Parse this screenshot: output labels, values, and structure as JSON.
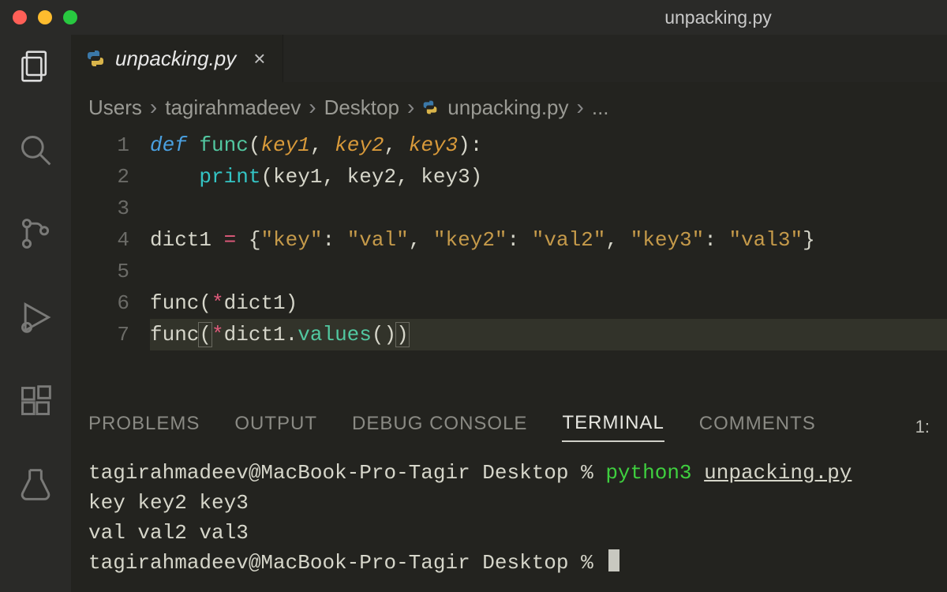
{
  "window": {
    "title": "unpacking.py"
  },
  "activitybar": {
    "items": [
      {
        "name": "explorer-icon",
        "active": true
      },
      {
        "name": "search-icon",
        "active": false
      },
      {
        "name": "source-control-icon",
        "active": false
      },
      {
        "name": "run-debug-icon",
        "active": false
      },
      {
        "name": "extensions-icon",
        "active": false
      },
      {
        "name": "testing-icon",
        "active": false
      }
    ]
  },
  "tab": {
    "filename": "unpacking.py",
    "icon": "python-file-icon",
    "close_label": "×"
  },
  "breadcrumbs": {
    "segments": [
      "Users",
      "tagirahmadeev",
      "Desktop",
      "unpacking.py",
      "..."
    ],
    "file_icon": "python-file-icon"
  },
  "editor": {
    "line_numbers": [
      "1",
      "2",
      "3",
      "4",
      "5",
      "6",
      "7"
    ],
    "code_lines": [
      {
        "raw": "def func(key1, key2, key3):",
        "tokens": [
          {
            "t": "def ",
            "c": "tok-kw"
          },
          {
            "t": "func",
            "c": "tok-fn"
          },
          {
            "t": "(",
            "c": "tok-ident"
          },
          {
            "t": "key1",
            "c": "tok-param"
          },
          {
            "t": ", ",
            "c": "tok-ident"
          },
          {
            "t": "key2",
            "c": "tok-param"
          },
          {
            "t": ", ",
            "c": "tok-ident"
          },
          {
            "t": "key3",
            "c": "tok-param"
          },
          {
            "t": "):",
            "c": "tok-ident"
          }
        ]
      },
      {
        "raw": "    print(key1, key2, key3)",
        "tokens": [
          {
            "t": "    ",
            "c": ""
          },
          {
            "t": "print",
            "c": "tok-print"
          },
          {
            "t": "(key1, key2, key3)",
            "c": "tok-ident"
          }
        ]
      },
      {
        "raw": "",
        "tokens": []
      },
      {
        "raw": "dict1 = {\"key\": \"val\", \"key2\": \"val2\", \"key3\": \"val3\"}",
        "tokens": [
          {
            "t": "dict1 ",
            "c": "tok-ident"
          },
          {
            "t": "=",
            "c": "tok-op"
          },
          {
            "t": " {",
            "c": "tok-ident"
          },
          {
            "t": "\"key\"",
            "c": "tok-str"
          },
          {
            "t": ": ",
            "c": "tok-ident"
          },
          {
            "t": "\"val\"",
            "c": "tok-str"
          },
          {
            "t": ", ",
            "c": "tok-ident"
          },
          {
            "t": "\"key2\"",
            "c": "tok-str"
          },
          {
            "t": ": ",
            "c": "tok-ident"
          },
          {
            "t": "\"val2\"",
            "c": "tok-str"
          },
          {
            "t": ", ",
            "c": "tok-ident"
          },
          {
            "t": "\"key3\"",
            "c": "tok-str"
          },
          {
            "t": ": ",
            "c": "tok-ident"
          },
          {
            "t": "\"val3\"",
            "c": "tok-str"
          },
          {
            "t": "}",
            "c": "tok-ident"
          }
        ]
      },
      {
        "raw": "",
        "tokens": []
      },
      {
        "raw": "func(*dict1)",
        "tokens": [
          {
            "t": "func",
            "c": "tok-ident"
          },
          {
            "t": "(",
            "c": "tok-ident"
          },
          {
            "t": "*",
            "c": "tok-op"
          },
          {
            "t": "dict1)",
            "c": "tok-ident"
          }
        ]
      },
      {
        "raw": "func(*dict1.values())",
        "current": true,
        "tokens": [
          {
            "t": "func",
            "c": "tok-ident"
          },
          {
            "t": "(",
            "c": "tok-ident bracket-hi"
          },
          {
            "t": "*",
            "c": "tok-op"
          },
          {
            "t": "dict1.",
            "c": "tok-ident"
          },
          {
            "t": "values",
            "c": "tok-call"
          },
          {
            "t": "()",
            "c": "tok-ident"
          },
          {
            "t": ")",
            "c": "tok-ident bracket-hi"
          }
        ]
      }
    ]
  },
  "panel": {
    "tabs": [
      "PROBLEMS",
      "OUTPUT",
      "DEBUG CONSOLE",
      "TERMINAL",
      "COMMENTS"
    ],
    "active_tab": "TERMINAL",
    "trailing": "1:"
  },
  "terminal": {
    "lines": [
      {
        "segments": [
          {
            "t": "tagirahmadeev@MacBook-Pro-Tagir Desktop % ",
            "c": "term-user"
          },
          {
            "t": "python3 ",
            "c": "term-cmd"
          },
          {
            "t": "unpacking.py",
            "c": "term-file"
          }
        ]
      },
      {
        "segments": [
          {
            "t": "key key2 key3",
            "c": "term-user"
          }
        ]
      },
      {
        "segments": [
          {
            "t": "val val2 val3",
            "c": "term-user"
          }
        ]
      },
      {
        "segments": [
          {
            "t": "tagirahmadeev@MacBook-Pro-Tagir Desktop % ",
            "c": "term-user"
          }
        ],
        "cursor": true
      }
    ]
  }
}
